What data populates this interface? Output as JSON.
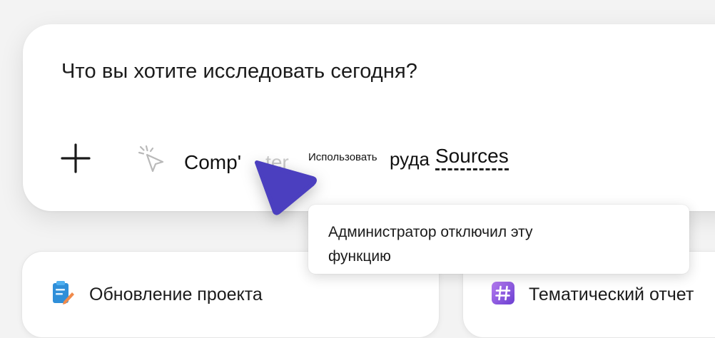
{
  "composer": {
    "prompt": "Что вы хотите исследовать сегодня?",
    "add_icon": "plus-icon",
    "computer_use": {
      "icon": "cursor-click-icon",
      "label_start": "Comp'",
      "label_faded": "ter",
      "use_label": "Использовать",
      "tools_label": "руда",
      "sources_label": "Sources"
    }
  },
  "tooltip": {
    "text": "Администратор отключил эту функцию"
  },
  "cards": [
    {
      "icon": "clipboard-edit-icon",
      "title": "Обновление проекта"
    },
    {
      "icon": "hashtag-icon",
      "title": "Тематический отчет"
    }
  ],
  "colors": {
    "pointer": "#4b3fbf",
    "hashtag_icon": "#8a5be0",
    "clipboard_icon": "#2f8fd9"
  }
}
